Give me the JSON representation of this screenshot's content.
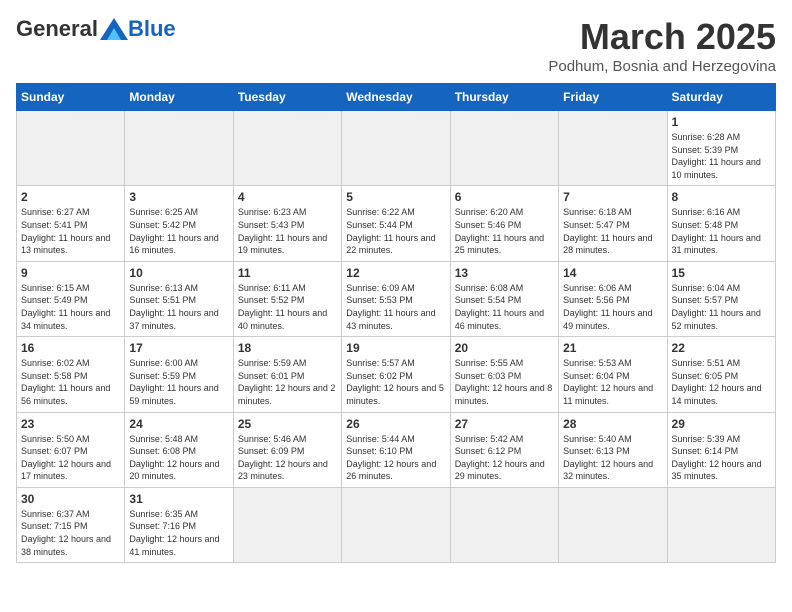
{
  "header": {
    "logo_general": "General",
    "logo_blue": "Blue",
    "month_title": "March 2025",
    "subtitle": "Podhum, Bosnia and Herzegovina"
  },
  "days_of_week": [
    "Sunday",
    "Monday",
    "Tuesday",
    "Wednesday",
    "Thursday",
    "Friday",
    "Saturday"
  ],
  "weeks": [
    [
      {
        "day": "",
        "info": ""
      },
      {
        "day": "",
        "info": ""
      },
      {
        "day": "",
        "info": ""
      },
      {
        "day": "",
        "info": ""
      },
      {
        "day": "",
        "info": ""
      },
      {
        "day": "",
        "info": ""
      },
      {
        "day": "1",
        "info": "Sunrise: 6:28 AM\nSunset: 5:39 PM\nDaylight: 11 hours\nand 10 minutes."
      }
    ],
    [
      {
        "day": "2",
        "info": "Sunrise: 6:27 AM\nSunset: 5:41 PM\nDaylight: 11 hours\nand 13 minutes."
      },
      {
        "day": "3",
        "info": "Sunrise: 6:25 AM\nSunset: 5:42 PM\nDaylight: 11 hours\nand 16 minutes."
      },
      {
        "day": "4",
        "info": "Sunrise: 6:23 AM\nSunset: 5:43 PM\nDaylight: 11 hours\nand 19 minutes."
      },
      {
        "day": "5",
        "info": "Sunrise: 6:22 AM\nSunset: 5:44 PM\nDaylight: 11 hours\nand 22 minutes."
      },
      {
        "day": "6",
        "info": "Sunrise: 6:20 AM\nSunset: 5:46 PM\nDaylight: 11 hours\nand 25 minutes."
      },
      {
        "day": "7",
        "info": "Sunrise: 6:18 AM\nSunset: 5:47 PM\nDaylight: 11 hours\nand 28 minutes."
      },
      {
        "day": "8",
        "info": "Sunrise: 6:16 AM\nSunset: 5:48 PM\nDaylight: 11 hours\nand 31 minutes."
      }
    ],
    [
      {
        "day": "9",
        "info": "Sunrise: 6:15 AM\nSunset: 5:49 PM\nDaylight: 11 hours\nand 34 minutes."
      },
      {
        "day": "10",
        "info": "Sunrise: 6:13 AM\nSunset: 5:51 PM\nDaylight: 11 hours\nand 37 minutes."
      },
      {
        "day": "11",
        "info": "Sunrise: 6:11 AM\nSunset: 5:52 PM\nDaylight: 11 hours\nand 40 minutes."
      },
      {
        "day": "12",
        "info": "Sunrise: 6:09 AM\nSunset: 5:53 PM\nDaylight: 11 hours\nand 43 minutes."
      },
      {
        "day": "13",
        "info": "Sunrise: 6:08 AM\nSunset: 5:54 PM\nDaylight: 11 hours\nand 46 minutes."
      },
      {
        "day": "14",
        "info": "Sunrise: 6:06 AM\nSunset: 5:56 PM\nDaylight: 11 hours\nand 49 minutes."
      },
      {
        "day": "15",
        "info": "Sunrise: 6:04 AM\nSunset: 5:57 PM\nDaylight: 11 hours\nand 52 minutes."
      }
    ],
    [
      {
        "day": "16",
        "info": "Sunrise: 6:02 AM\nSunset: 5:58 PM\nDaylight: 11 hours\nand 56 minutes."
      },
      {
        "day": "17",
        "info": "Sunrise: 6:00 AM\nSunset: 5:59 PM\nDaylight: 11 hours\nand 59 minutes."
      },
      {
        "day": "18",
        "info": "Sunrise: 5:59 AM\nSunset: 6:01 PM\nDaylight: 12 hours\nand 2 minutes."
      },
      {
        "day": "19",
        "info": "Sunrise: 5:57 AM\nSunset: 6:02 PM\nDaylight: 12 hours\nand 5 minutes."
      },
      {
        "day": "20",
        "info": "Sunrise: 5:55 AM\nSunset: 6:03 PM\nDaylight: 12 hours\nand 8 minutes."
      },
      {
        "day": "21",
        "info": "Sunrise: 5:53 AM\nSunset: 6:04 PM\nDaylight: 12 hours\nand 11 minutes."
      },
      {
        "day": "22",
        "info": "Sunrise: 5:51 AM\nSunset: 6:05 PM\nDaylight: 12 hours\nand 14 minutes."
      }
    ],
    [
      {
        "day": "23",
        "info": "Sunrise: 5:50 AM\nSunset: 6:07 PM\nDaylight: 12 hours\nand 17 minutes."
      },
      {
        "day": "24",
        "info": "Sunrise: 5:48 AM\nSunset: 6:08 PM\nDaylight: 12 hours\nand 20 minutes."
      },
      {
        "day": "25",
        "info": "Sunrise: 5:46 AM\nSunset: 6:09 PM\nDaylight: 12 hours\nand 23 minutes."
      },
      {
        "day": "26",
        "info": "Sunrise: 5:44 AM\nSunset: 6:10 PM\nDaylight: 12 hours\nand 26 minutes."
      },
      {
        "day": "27",
        "info": "Sunrise: 5:42 AM\nSunset: 6:12 PM\nDaylight: 12 hours\nand 29 minutes."
      },
      {
        "day": "28",
        "info": "Sunrise: 5:40 AM\nSunset: 6:13 PM\nDaylight: 12 hours\nand 32 minutes."
      },
      {
        "day": "29",
        "info": "Sunrise: 5:39 AM\nSunset: 6:14 PM\nDaylight: 12 hours\nand 35 minutes."
      }
    ],
    [
      {
        "day": "30",
        "info": "Sunrise: 6:37 AM\nSunset: 7:15 PM\nDaylight: 12 hours\nand 38 minutes."
      },
      {
        "day": "31",
        "info": "Sunrise: 6:35 AM\nSunset: 7:16 PM\nDaylight: 12 hours\nand 41 minutes."
      },
      {
        "day": "",
        "info": ""
      },
      {
        "day": "",
        "info": ""
      },
      {
        "day": "",
        "info": ""
      },
      {
        "day": "",
        "info": ""
      },
      {
        "day": "",
        "info": ""
      }
    ]
  ]
}
